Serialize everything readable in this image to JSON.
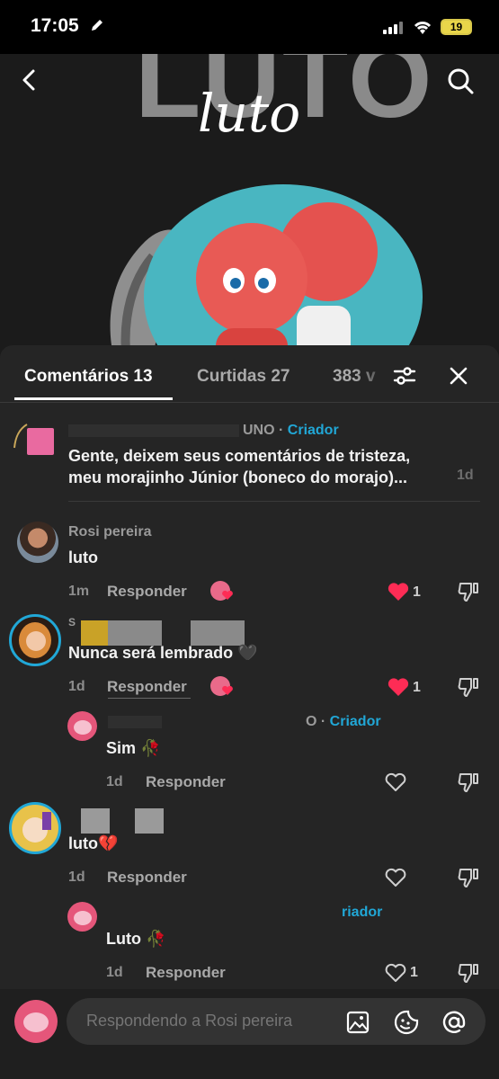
{
  "status_bar": {
    "time": "17:05",
    "battery": "19"
  },
  "video": {
    "title_big": "LUTO",
    "title_script": "luto"
  },
  "tabs": [
    {
      "label": "Comentários 13"
    },
    {
      "label": "Curtidas 27"
    },
    {
      "label": "383 v"
    }
  ],
  "pinned": {
    "author": "UNO",
    "separator": " · ",
    "creator_label": "Criador",
    "text_line1": "Gente, deixem seus comentários de tristeza,",
    "text_line2": "meu morajinho Júnior (boneco do morajo)...",
    "time": "1d"
  },
  "comments": [
    {
      "author": "Rosi pereira",
      "text": "luto",
      "time": "1m",
      "reply_label": "Responder",
      "likes": "1",
      "liked": true
    },
    {
      "author": "S",
      "text": "Nunca será lembrado 🖤",
      "time": "1d",
      "reply_label": "Responder",
      "likes": "1",
      "liked": true
    },
    {
      "author": "O",
      "separator": " · ",
      "creator_label": "Criador",
      "text": "Sim 🥀",
      "time": "1d",
      "reply_label": "Responder",
      "likes": "",
      "liked": false
    },
    {
      "author": "",
      "text": "luto💔",
      "time": "1d",
      "reply_label": "Responder",
      "likes": "",
      "liked": false
    },
    {
      "author": "",
      "creator_label": "riador",
      "text": "Luto 🥀",
      "time": "1d",
      "reply_label": "Responder",
      "likes": "1",
      "liked": false
    }
  ],
  "input": {
    "placeholder": "Respondendo a Rosi pereira"
  },
  "colors": {
    "accent_creator": "#21a7d6",
    "like_red": "#fe2c55",
    "sheet_bg": "#252525"
  }
}
